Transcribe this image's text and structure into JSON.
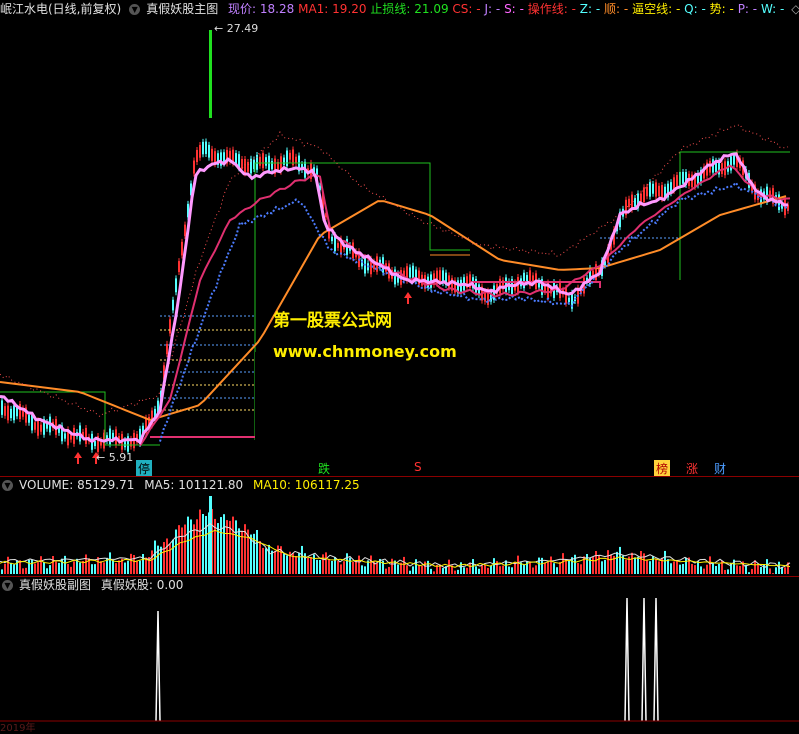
{
  "main_header": {
    "stock": "岷江水电(日线,前复权)",
    "indicator": "真假妖股主图",
    "price_label": "现价:",
    "price_value": "18.28",
    "ma1_label": "MA1:",
    "ma1_value": "19.20",
    "stop_label": "止损线:",
    "stop_value": "21.09",
    "cs_label": "CS:",
    "cs_value": "-",
    "j_label": "J:",
    "j_value": "-",
    "s_label": "S:",
    "s_value": "-",
    "op_label": "操作线:",
    "op_value": "-",
    "z_label": "Z:",
    "z_value": "-",
    "shun_label": "顺:",
    "shun_value": "-",
    "tk_label": "逼空线:",
    "tk_value": "-",
    "q_label": "Q:",
    "q_value": "-",
    "shi_label": "势:",
    "shi_value": "-",
    "p_label": "P:",
    "p_value": "-",
    "w_label": "W:",
    "w_value": "-",
    "nav_glyph": "◇"
  },
  "price_marks": {
    "high": "27.49",
    "low": "5.91"
  },
  "watermark": {
    "title": "第一股票公式网",
    "url": "www.chnmoney.com"
  },
  "signals": {
    "ting": "停",
    "die": "跌",
    "s": "S",
    "bang": "榜",
    "zhang": "涨",
    "cai": "财"
  },
  "volume_header": {
    "volume_label": "VOLUME:",
    "volume_value": "85129.71",
    "ma5_label": "MA5:",
    "ma5_value": "101121.80",
    "ma10_label": "MA10:",
    "ma10_value": "106117.25"
  },
  "indicator_header": {
    "title": "真假妖股副图",
    "series_label": "真假妖股:",
    "series_value": "0.00"
  },
  "colors": {
    "up": "#ff3232",
    "down": "#54ffff",
    "ma_pink": "#ff99ff",
    "ma_orange": "#ff8c28",
    "ma_red": "#e03070",
    "ma_blue": "#4c7cff",
    "stop_green": "#20c020",
    "header_purple": "#c080ff",
    "header_yellow": "#ffee00"
  },
  "date_axis": {
    "first_label": "2019年"
  }
}
